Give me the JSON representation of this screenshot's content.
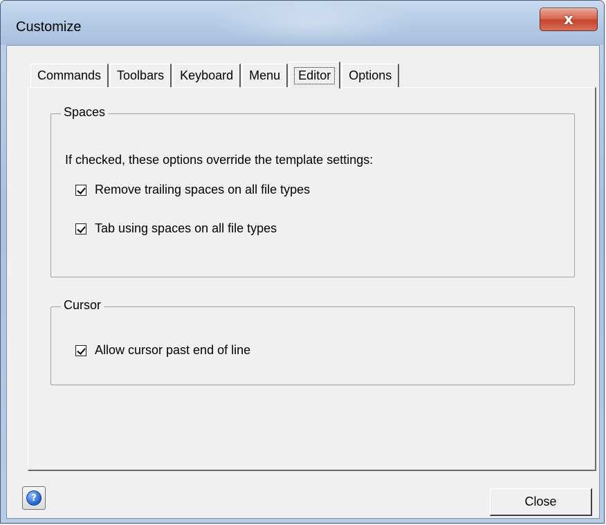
{
  "window": {
    "title": "Customize",
    "close_glyph": "x"
  },
  "tabs": [
    {
      "label": "Commands",
      "active": false
    },
    {
      "label": "Toolbars",
      "active": false
    },
    {
      "label": "Keyboard",
      "active": false
    },
    {
      "label": "Menu",
      "active": false
    },
    {
      "label": "Editor",
      "active": true
    },
    {
      "label": "Options",
      "active": false
    }
  ],
  "spaces": {
    "legend": "Spaces",
    "instruction": "If checked, these options override the template settings:",
    "options": [
      {
        "label": "Remove trailing spaces on all file types",
        "checked": true
      },
      {
        "label": "Tab using spaces on all file types",
        "checked": true
      }
    ]
  },
  "cursor": {
    "legend": "Cursor",
    "options": [
      {
        "label": "Allow cursor past end of line",
        "checked": true
      }
    ]
  },
  "footer": {
    "help_icon": "help-icon",
    "help_glyph": "?",
    "close_label": "Close"
  }
}
